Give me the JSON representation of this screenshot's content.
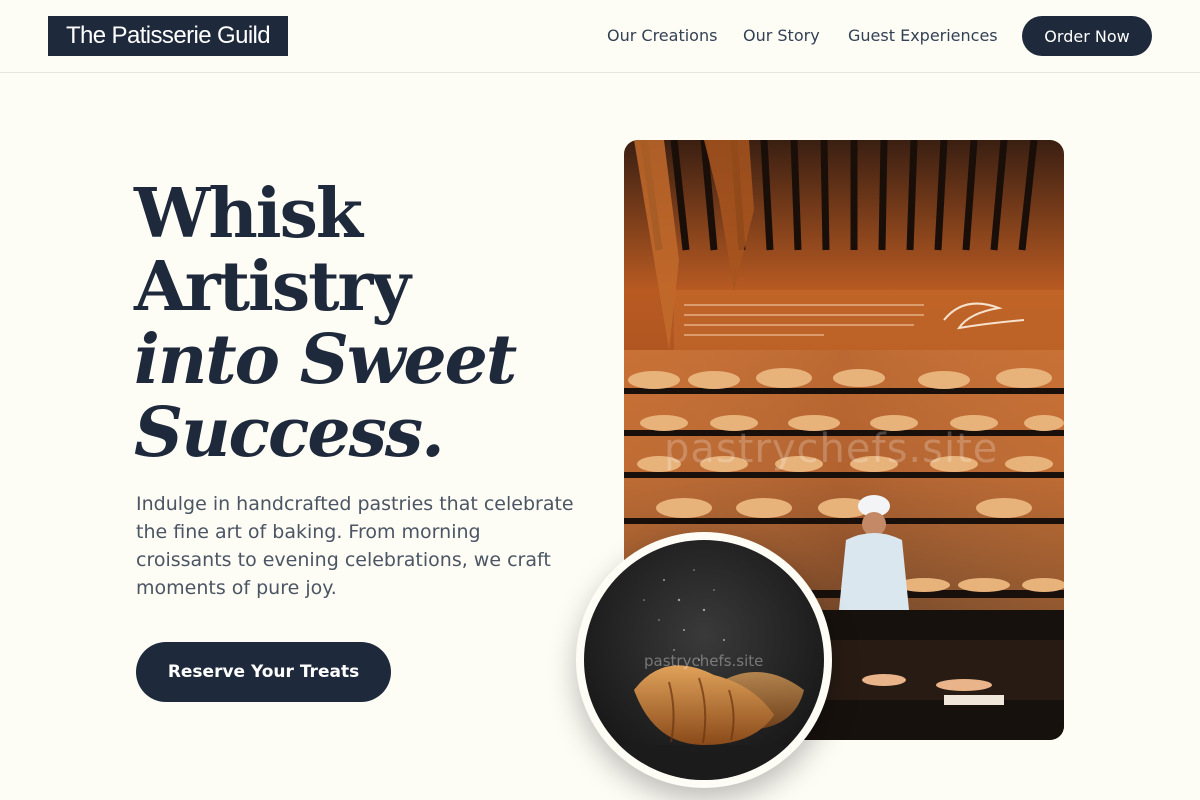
{
  "header": {
    "logo": "The Patisserie Guild",
    "nav": [
      "Our Creations",
      "Our Story",
      "Guest Experiences"
    ],
    "cta_label": "Order Now"
  },
  "hero": {
    "headline_lines": [
      "Whisk",
      "Artistry",
      "into Sweet",
      "Success."
    ],
    "lead": "Indulge in handcrafted pastries that celebrate the fine art of baking. From morning croissants to evening celebrations, we craft moments of pure joy.",
    "cta_label": "Reserve Your Treats"
  },
  "images": {
    "bakery_watermark": "pastrychefs.site",
    "croissant_watermark": "pastrychefs.site"
  },
  "colors": {
    "navy": "#1e293b",
    "background": "#fdfcf5",
    "body_text": "#4b5563"
  }
}
